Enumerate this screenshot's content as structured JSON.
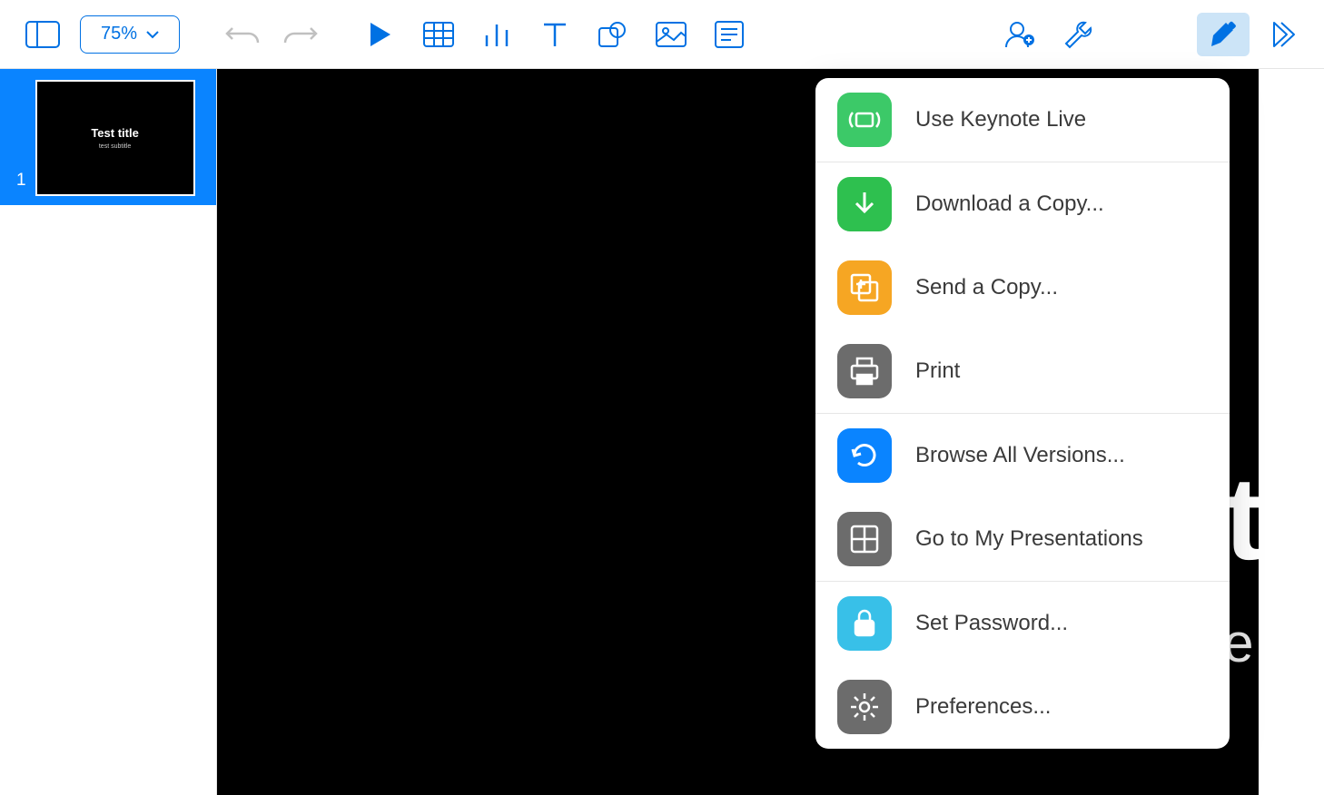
{
  "toolbar": {
    "zoom": "75%"
  },
  "slides": [
    {
      "number": "1",
      "title": "Test title",
      "subtitle": "test subtitle"
    }
  ],
  "canvas": {
    "title": "Test title",
    "subtitle": "test subtitle"
  },
  "menu": {
    "keynote_live": "Use Keynote Live",
    "download": "Download a Copy...",
    "send": "Send a Copy...",
    "print": "Print",
    "browse": "Browse All Versions...",
    "goto": "Go to My Presentations",
    "password": "Set Password...",
    "prefs": "Preferences..."
  }
}
